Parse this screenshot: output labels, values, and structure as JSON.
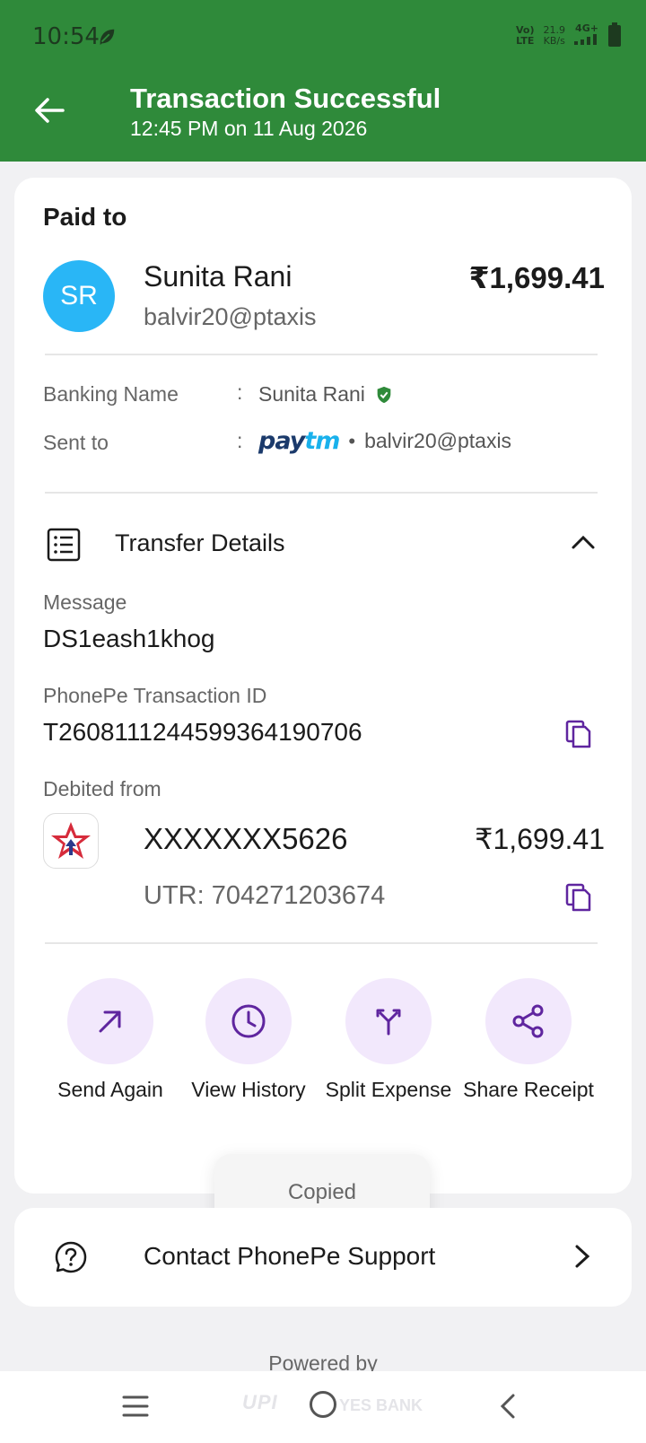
{
  "status_bar": {
    "time": "10:54",
    "network_top": "Vo)",
    "network_bottom": "LTE",
    "speed_top": "21.9",
    "speed_bottom": "KB/s",
    "signal": "4G+"
  },
  "header": {
    "title": "Transaction Successful",
    "subtitle": "12:45 PM on 11 Aug 2026"
  },
  "payee": {
    "section_label": "Paid to",
    "initials": "SR",
    "name": "Sunita Rani",
    "upi_id": "balvir20@ptaxis",
    "amount": "₹1,699.41"
  },
  "details": {
    "banking_name_label": "Banking Name",
    "banking_name_value": "Sunita Rani",
    "sent_to_label": "Sent to",
    "sent_to_value": "balvir20@ptaxis",
    "paytm_part1": "pay",
    "paytm_part2": "tm",
    "colon": ":",
    "dot": "•"
  },
  "transfer": {
    "title": "Transfer Details",
    "message_label": "Message",
    "message_value": "DS1eash1khog",
    "txn_id_label": "PhonePe Transaction ID",
    "txn_id_value": "T2608111244599364190706",
    "debited_label": "Debited from",
    "account": "XXXXXXX5626",
    "account_amount": "₹1,699.41",
    "utr": "UTR: 704271203674"
  },
  "actions": [
    {
      "label": "Send Again",
      "icon": "arrow-up-right-icon"
    },
    {
      "label": "View History",
      "icon": "clock-icon"
    },
    {
      "label": "Split Expense",
      "icon": "split-icon"
    },
    {
      "label": "Share Receipt",
      "icon": "share-icon"
    }
  ],
  "toast": {
    "text": "Copied"
  },
  "support": {
    "text": "Contact PhonePe Support"
  },
  "footer": {
    "powered_by": "Powered by",
    "upi_text": "UPI",
    "bank_text": "YES BANK"
  },
  "colors": {
    "header": "#2f8a3a",
    "accent": "#5f259f",
    "action_bg": "#f2e8fc",
    "avatar": "#29b6f6"
  }
}
